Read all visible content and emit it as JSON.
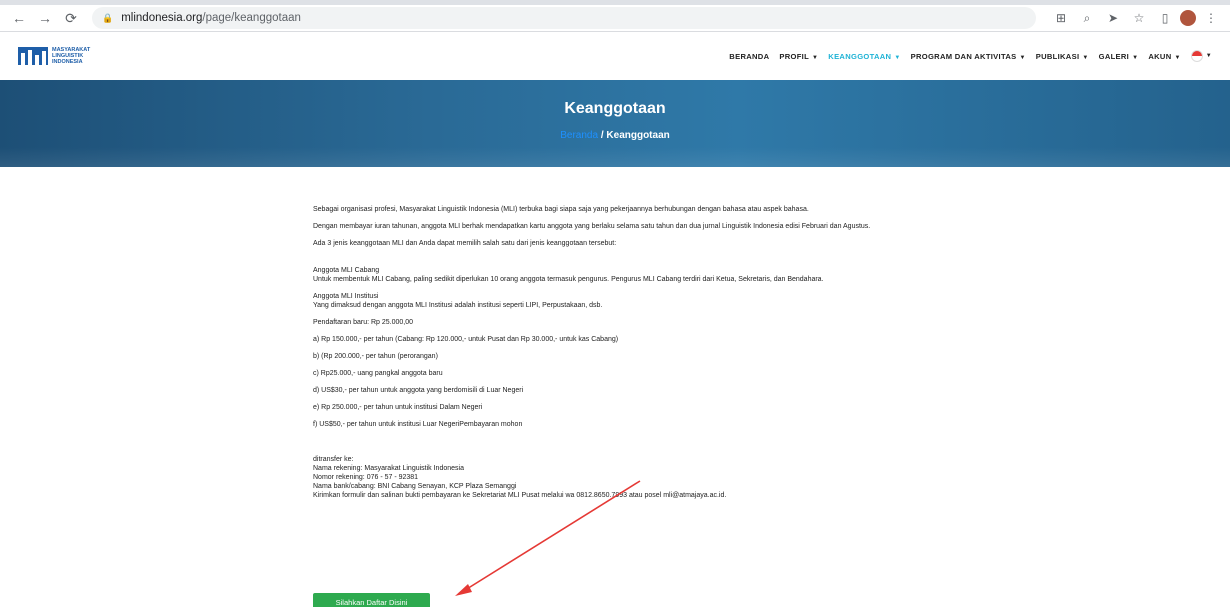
{
  "browser": {
    "url_host": "mlindonesia.org",
    "url_path": "/page/keanggotaan"
  },
  "site": {
    "logo_lines": [
      "MASYARAKAT",
      "LINGUISTIK",
      "INDONESIA"
    ],
    "menu": [
      {
        "label": "BERANDA",
        "has_caret": false,
        "active": false
      },
      {
        "label": "PROFIL",
        "has_caret": true,
        "active": false
      },
      {
        "label": "KEANGGOTAAN",
        "has_caret": true,
        "active": true
      },
      {
        "label": "PROGRAM DAN AKTIVITAS",
        "has_caret": true,
        "active": false
      },
      {
        "label": "PUBLIKASI",
        "has_caret": true,
        "active": false
      },
      {
        "label": "GALERI",
        "has_caret": true,
        "active": false
      },
      {
        "label": "AKUN",
        "has_caret": true,
        "active": false
      }
    ]
  },
  "banner": {
    "title": "Keanggotaan",
    "crumb_home": "Beranda",
    "crumb_sep": " / ",
    "crumb_current": "Keanggotaan"
  },
  "content": {
    "p1": "Sebagai organisasi profesi, Masyarakat Linguistik Indonesia (MLI) terbuka bagi siapa saja yang pekerjaannya berhubungan dengan bahasa atau aspek bahasa.",
    "p2": "Dengan membayar iuran tahunan, anggota MLI berhak mendapatkan kartu anggota yang berlaku selama satu tahun dan dua jurnal Linguistik Indonesia edisi Februari dan Agustus.",
    "p3": "Ada 3 jenis keanggotaan MLI dan Anda dapat memilih salah satu dari jenis keanggotaan tersebut:",
    "cabang_title": "Anggota MLI Cabang",
    "cabang_text": "Untuk membentuk MLI Cabang, paling sedikit diperlukan 10 orang anggota termasuk pengurus. Pengurus MLI Cabang terdiri dari Ketua, Sekretaris, dan Bendahara.",
    "institusi_title": "Anggota MLI Institusi",
    "institusi_text": "Yang dimaksud dengan anggota MLI Institusi adalah institusi seperti LIPI, Perpustakaan, dsb.",
    "pendaftaran": "Pendaftaran baru: Rp  25.000,00",
    "items": [
      "a) Rp 150.000,- per tahun (Cabang: Rp 120.000,- untuk Pusat dan Rp 30.000,- untuk kas Cabang)",
      "b) (Rp 200.000,- per tahun (perorangan)",
      "c) Rp25.000,- uang pangkal anggota baru",
      "d) US$30,- per tahun untuk anggota yang berdomisili di Luar Negeri",
      "e) Rp 250.000,- per tahun untuk institusi Dalam Negeri",
      "f) US$50,- per tahun untuk institusi Luar NegeriPembayaran mohon"
    ],
    "transfer": [
      "ditransfer ke:",
      "Nama rekening: Masyarakat Linguistik Indonesia",
      "Nomor rekening: 076 - 57 - 92381",
      "Nama bank/cabang: BNI Cabang Senayan, KCP Plaza Semanggi",
      "Kirimkan formulir dan salinan bukti pembayaran ke Sekretariat MLI Pusat melalui wa 0812.8650.7993 atau posel mli@atmajaya.ac.id."
    ],
    "button_label": "Silahkan Daftar Disini"
  }
}
